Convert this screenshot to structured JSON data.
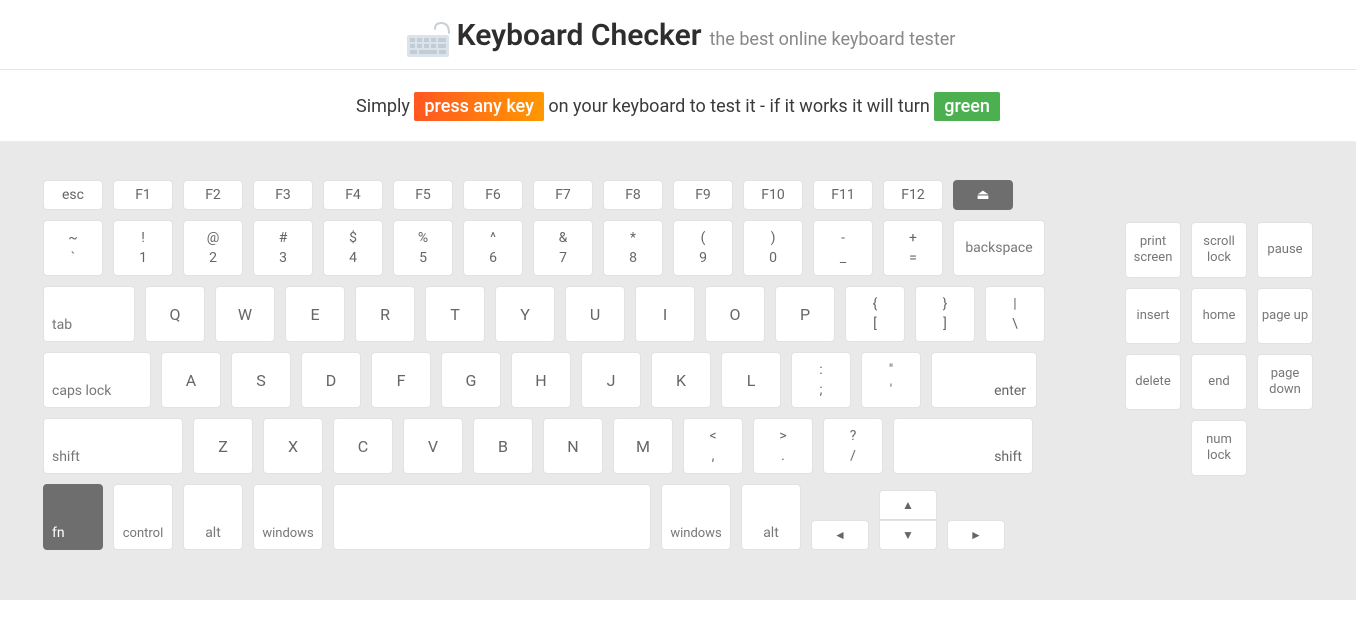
{
  "header": {
    "title": "Keyboard Checker",
    "subtitle": "the best online keyboard tester"
  },
  "instructions": {
    "pre": "Simply ",
    "badge1": "press any key",
    "mid": " on your keyboard to test it - if it works it will turn ",
    "badge2": "green"
  },
  "fnrow": {
    "esc": "esc",
    "f1": "F1",
    "f2": "F2",
    "f3": "F3",
    "f4": "F4",
    "f5": "F5",
    "f6": "F6",
    "f7": "F7",
    "f8": "F8",
    "f9": "F9",
    "f10": "F10",
    "f11": "F11",
    "f12": "F12",
    "eject": "⏏"
  },
  "row1": {
    "tilde_top": "~",
    "tilde_bot": "`",
    "k1_top": "!",
    "k1_bot": "1",
    "k2_top": "@",
    "k2_bot": "2",
    "k3_top": "#",
    "k3_bot": "3",
    "k4_top": "$",
    "k4_bot": "4",
    "k5_top": "%",
    "k5_bot": "5",
    "k6_top": "^",
    "k6_bot": "6",
    "k7_top": "&",
    "k7_bot": "7",
    "k8_top": "*",
    "k8_bot": "8",
    "k9_top": "(",
    "k9_bot": "9",
    "k0_top": ")",
    "k0_bot": "0",
    "minus_top": "-",
    "minus_bot": "_",
    "eq_top": "+",
    "eq_bot": "=",
    "backspace": "backspace"
  },
  "row2": {
    "tab": "tab",
    "q": "Q",
    "w": "W",
    "e": "E",
    "r": "R",
    "t": "T",
    "y": "Y",
    "u": "U",
    "i": "I",
    "o": "O",
    "p": "P",
    "lb_top": "{",
    "lb_bot": "[",
    "rb_top": "}",
    "rb_bot": "]",
    "bs_top": "|",
    "bs_bot": "\\"
  },
  "row3": {
    "caps": "caps lock",
    "a": "A",
    "s": "S",
    "d": "D",
    "f": "F",
    "g": "G",
    "h": "H",
    "j": "J",
    "k": "K",
    "l": "L",
    "semi_top": ":",
    "semi_bot": ";",
    "quote_top": "\"",
    "quote_bot": "'",
    "enter": "enter"
  },
  "row4": {
    "lshift": "shift",
    "z": "Z",
    "x": "X",
    "c": "C",
    "v": "V",
    "b": "B",
    "n": "N",
    "m": "M",
    "comma_top": "<",
    "comma_bot": ",",
    "period_top": ">",
    "period_bot": ".",
    "slash_top": "?",
    "slash_bot": "/",
    "rshift": "shift"
  },
  "row5": {
    "fn": "fn",
    "lctrl": "control",
    "lalt": "alt",
    "lwin": "windows",
    "rwin": "windows",
    "ralt": "alt",
    "left": "◄",
    "up": "▲",
    "down": "▼",
    "right": "►"
  },
  "side": {
    "print": "print screen",
    "scroll": "scroll lock",
    "pause": "pause",
    "insert": "insert",
    "home": "home",
    "pgup": "page up",
    "delete": "delete",
    "end": "end",
    "pgdn": "page down",
    "numlock": "num lock"
  }
}
